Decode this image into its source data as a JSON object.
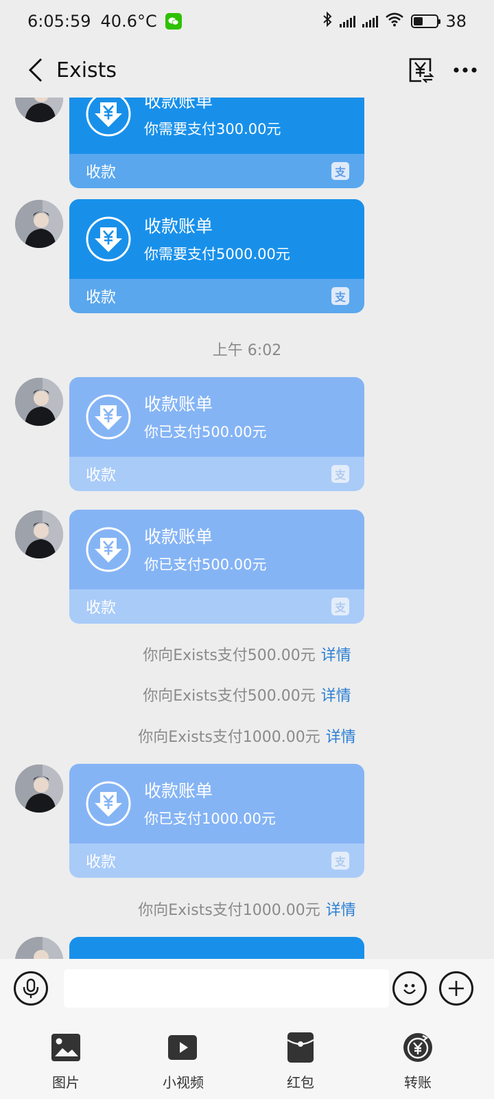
{
  "status_bar": {
    "time": "6:05:59",
    "temperature": "40.6°C",
    "battery": "38",
    "app_icon": "wechat-icon"
  },
  "header": {
    "title": "Exists",
    "back_icon": "chevron-left-icon",
    "transfer_icon": "yuan-transfer-icon",
    "more_icon": "more-dots-icon"
  },
  "messages": [
    {
      "type": "collect",
      "state": "pending",
      "title": "收款账单",
      "desc": "你需要支付300.00元",
      "footer": "收款",
      "badge": "支"
    },
    {
      "type": "collect",
      "state": "pending",
      "title": "收款账单",
      "desc": "你需要支付5000.00元",
      "footer": "收款",
      "badge": "支"
    },
    {
      "type": "time",
      "text": "上午 6:02"
    },
    {
      "type": "collect",
      "state": "paid",
      "title": "收款账单",
      "desc": "你已支付500.00元",
      "footer": "收款",
      "badge": "支"
    },
    {
      "type": "collect",
      "state": "paid",
      "title": "收款账单",
      "desc": "你已支付500.00元",
      "footer": "收款",
      "badge": "支"
    },
    {
      "type": "system",
      "text": "你向Exists支付500.00元",
      "link": "详情"
    },
    {
      "type": "system",
      "text": "你向Exists支付500.00元",
      "link": "详情"
    },
    {
      "type": "system",
      "text": "你向Exists支付1000.00元",
      "link": "详情"
    },
    {
      "type": "collect",
      "state": "paid",
      "title": "收款账单",
      "desc": "你已支付1000.00元",
      "footer": "收款",
      "badge": "支"
    },
    {
      "type": "system",
      "text": "你向Exists支付1000.00元",
      "link": "详情"
    }
  ],
  "input_bar": {
    "placeholder": "",
    "voice_icon": "microphone-icon",
    "emoji_icon": "smiley-icon",
    "plus_icon": "plus-icon"
  },
  "toolbar": [
    {
      "label": "图片",
      "icon": "image-icon"
    },
    {
      "label": "小视频",
      "icon": "video-icon"
    },
    {
      "label": "红包",
      "icon": "red-packet-icon"
    },
    {
      "label": "转账",
      "icon": "transfer-icon"
    }
  ],
  "colors": {
    "card_pending": "#1890ea",
    "card_pending_footer": "#5aa7ee",
    "card_paid": "#85b4f5",
    "card_paid_footer": "#a9cbf8",
    "link": "#2a7fd4",
    "background": "#ededed"
  }
}
